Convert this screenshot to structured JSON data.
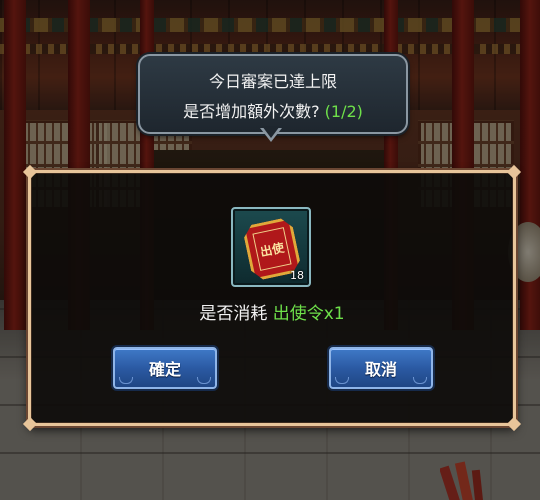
{
  "tooltip": {
    "line1": "今日審案已達上限",
    "line2_prefix": "是否增加額外次數?",
    "count": "(1/2)"
  },
  "dialog": {
    "item": {
      "icon": "seal-token-icon",
      "glyph": "出使",
      "quantity": "18"
    },
    "consume_prefix": "是否消耗 ",
    "consume_item": "出使令x1",
    "confirm_label": "確定",
    "cancel_label": "取消"
  },
  "colors": {
    "highlight_green": "#6ee04a",
    "button_blue": "#2b5aa3",
    "frame_gold": "#e8c59a"
  }
}
